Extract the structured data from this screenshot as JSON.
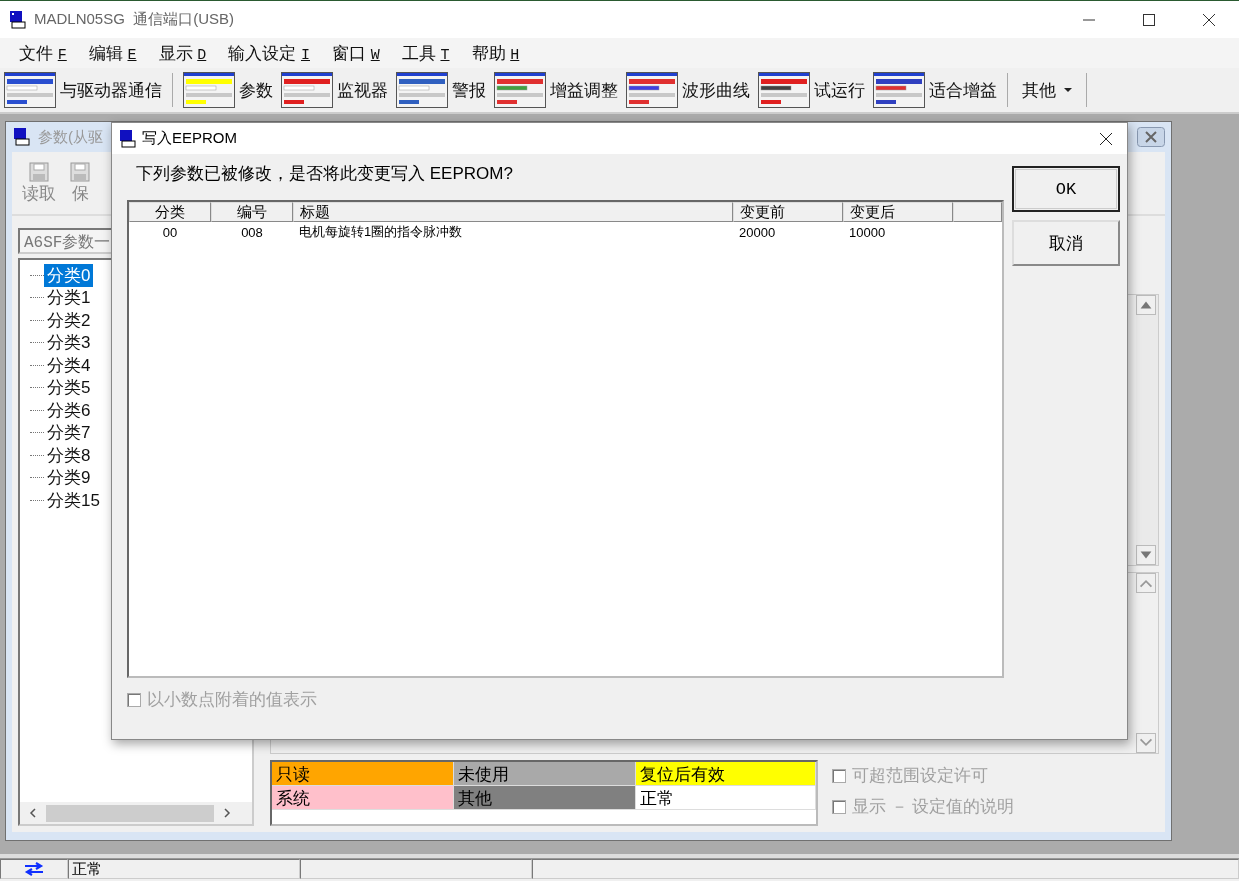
{
  "window": {
    "title": "MADLN05SG  通信端口(USB)"
  },
  "menu": [
    {
      "label": "文件",
      "key": "F"
    },
    {
      "label": "编辑",
      "key": "E"
    },
    {
      "label": "显示",
      "key": "D"
    },
    {
      "label": "输入设定",
      "key": "I"
    },
    {
      "label": "窗口",
      "key": "W"
    },
    {
      "label": "工具",
      "key": "T"
    },
    {
      "label": "帮助",
      "key": "H"
    }
  ],
  "toolbar": {
    "buttons": [
      {
        "label": "与驱动器通信",
        "kind": "comm"
      },
      {
        "label": "参数",
        "kind": "param"
      },
      {
        "label": "监视器",
        "kind": "monitor"
      },
      {
        "label": "警报",
        "kind": "alarm"
      },
      {
        "label": "增益调整",
        "kind": "gain"
      },
      {
        "label": "波形曲线",
        "kind": "wave"
      },
      {
        "label": "试运行",
        "kind": "trial"
      },
      {
        "label": "适合增益",
        "kind": "fit"
      }
    ],
    "more": "其他"
  },
  "child_window": {
    "title": "参数(从驱",
    "toolbar": [
      "读取",
      "保"
    ],
    "dropdown": "A6SF参数一",
    "tree": [
      {
        "label": "分类0",
        "selected": true
      },
      {
        "label": "分类1",
        "selected": false
      },
      {
        "label": "分类2",
        "selected": false
      },
      {
        "label": "分类3",
        "selected": false
      },
      {
        "label": "分类4",
        "selected": false
      },
      {
        "label": "分类5",
        "selected": false
      },
      {
        "label": "分类6",
        "selected": false
      },
      {
        "label": "分类7",
        "selected": false
      },
      {
        "label": "分类8",
        "selected": false
      },
      {
        "label": "分类9",
        "selected": false
      },
      {
        "label": "分类15",
        "selected": false
      }
    ],
    "legend": [
      {
        "label": "只读",
        "color": "#ffa500"
      },
      {
        "label": "未使用",
        "color": "#a9a9a9"
      },
      {
        "label": "复位后有效",
        "color": "#ffff00"
      },
      {
        "label": "系统",
        "color": "#ffc0cb"
      },
      {
        "label": "其他",
        "color": "#808080"
      },
      {
        "label": "正常",
        "color": "#ffffff"
      }
    ],
    "options": [
      {
        "label": "可超范围设定许可",
        "checked": false,
        "disabled": true
      },
      {
        "label": "显示 － 设定值的说明",
        "checked": false,
        "disabled": true
      }
    ]
  },
  "dialog": {
    "title": "写入EEPROM",
    "message": "下列参数已被修改，是否将此变更写入 EEPROM?",
    "table": {
      "columns": [
        "分类",
        "编号",
        "标题",
        "变更前",
        "变更后"
      ],
      "rows": [
        [
          "00",
          "008",
          "电机每旋转1圈的指令脉冲数",
          "20000",
          "10000"
        ]
      ]
    },
    "buttons": [
      "OK",
      "取消"
    ],
    "option": {
      "label": "以小数点附着的值表示",
      "checked": false,
      "disabled": true
    }
  },
  "status_bar": {
    "text": "正常"
  }
}
